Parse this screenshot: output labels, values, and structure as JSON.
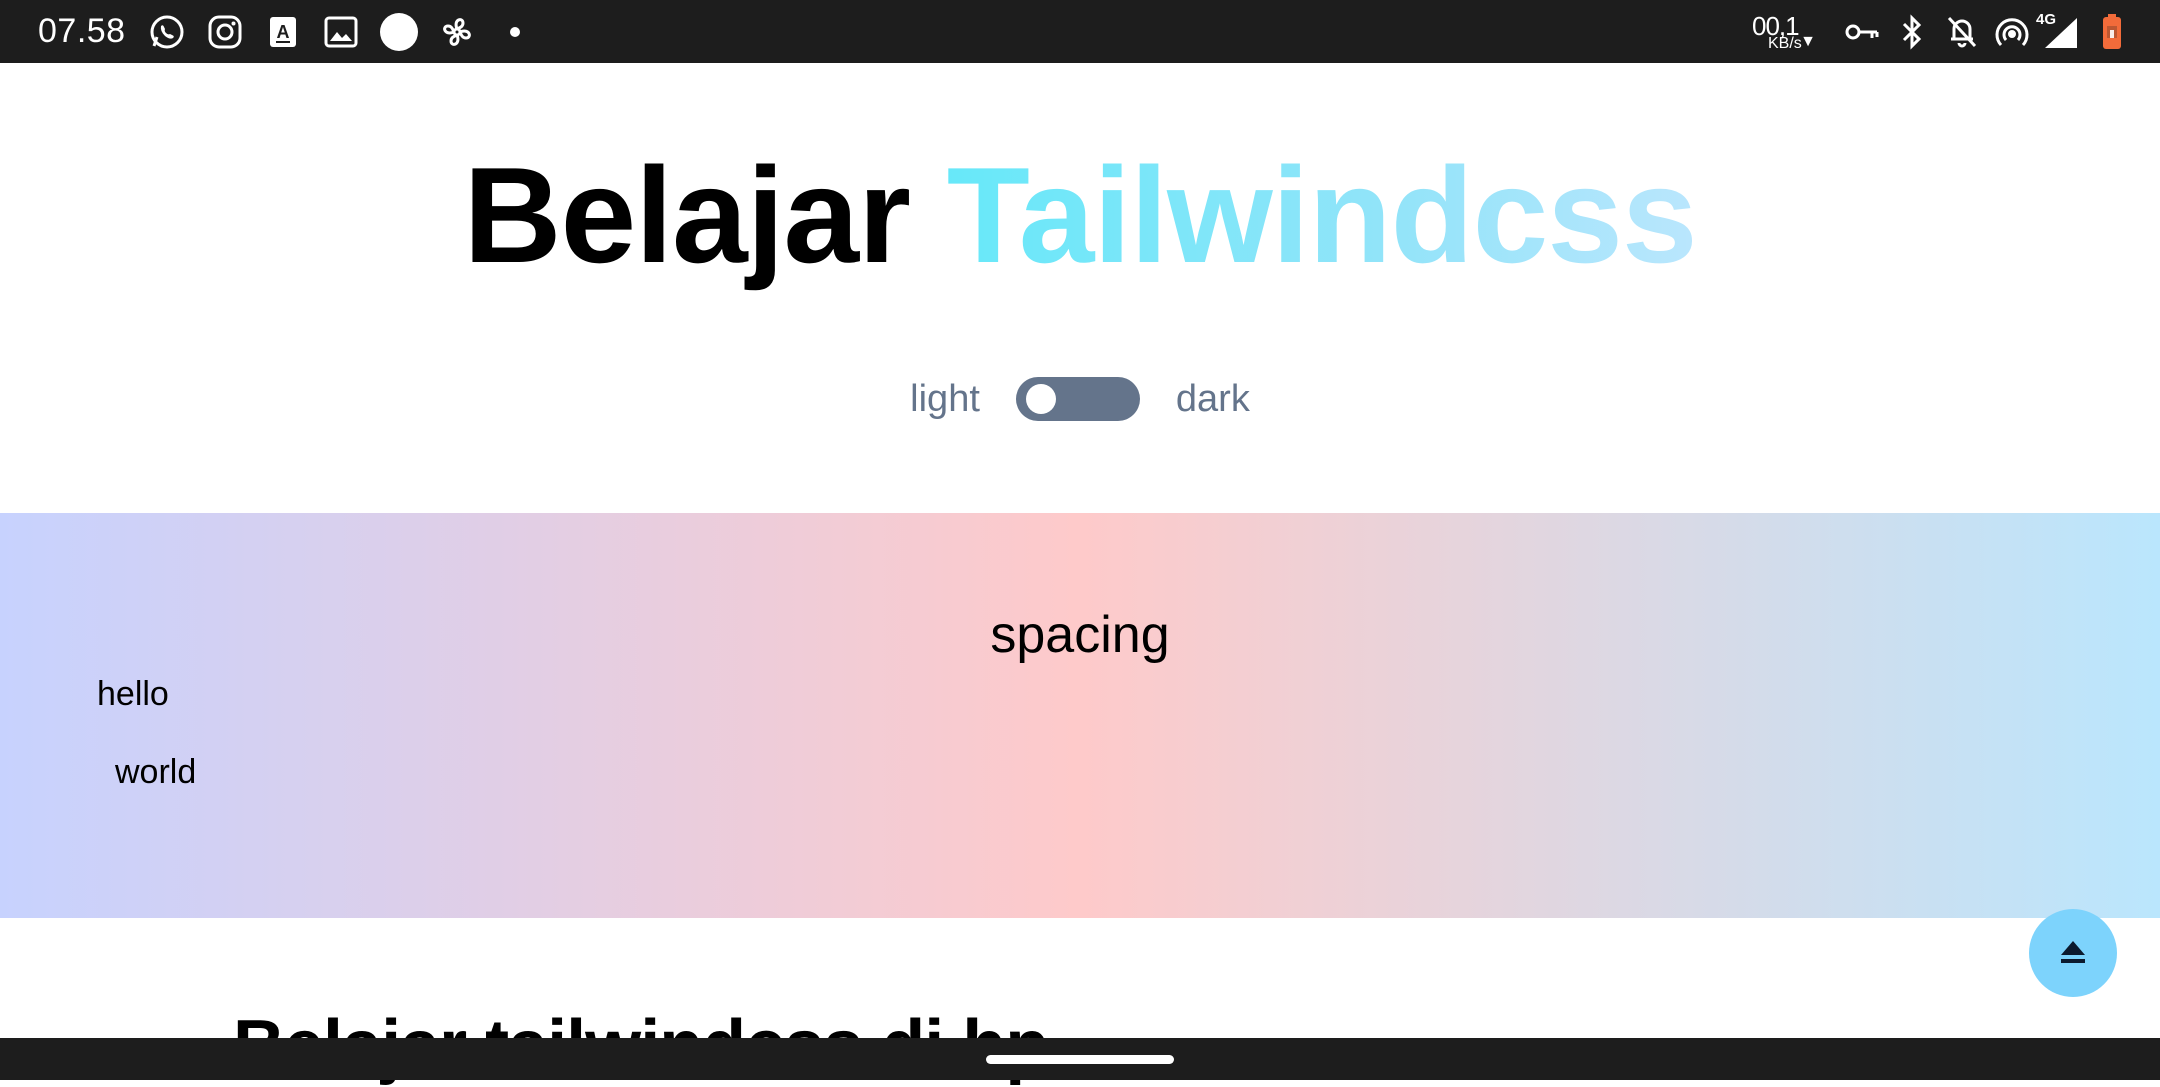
{
  "status_bar": {
    "time": "07.58",
    "left_icons": [
      "whatsapp-icon",
      "instagram-icon",
      "translate-icon",
      "gallery-icon",
      "circle-icon",
      "fan-icon",
      "dot-icon"
    ],
    "net_speed_value": "00,1",
    "net_speed_unit": "KB/s",
    "network_type": "4G",
    "right_icons": [
      "vpn-key-icon",
      "bluetooth-icon",
      "notifications-off-icon",
      "hotspot-icon",
      "signal-icon",
      "battery-icon"
    ],
    "battery_color": "#f26b3a"
  },
  "hero": {
    "title_plain": "Belajar ",
    "title_accent": "Tailwindcss"
  },
  "theme_toggle": {
    "light_label": "light",
    "dark_label": "dark",
    "state": "light"
  },
  "section": {
    "title": "spacing",
    "hello": "hello",
    "world": "world",
    "gradient": [
      "#c7d2fe",
      "#fecaca",
      "#bae6fd"
    ]
  },
  "next_section": {
    "heading": "Belajar tailwindcss di hp"
  },
  "fab": {
    "icon": "eject-icon",
    "color": "#7dd3fc"
  }
}
